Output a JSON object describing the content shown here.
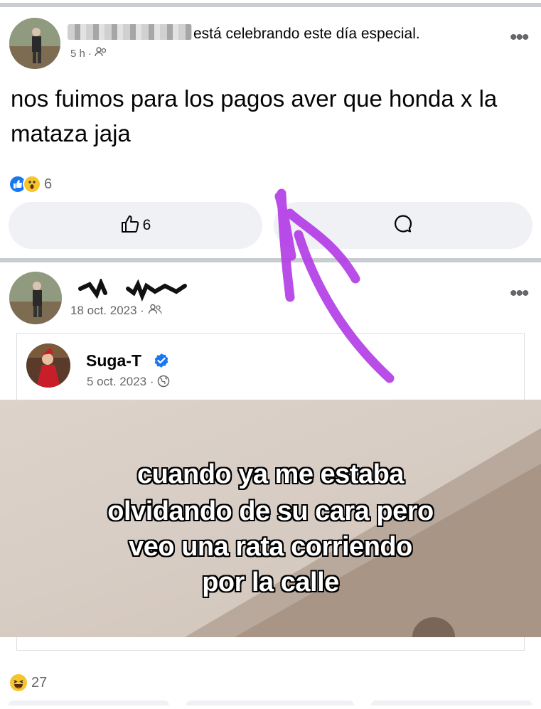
{
  "post1": {
    "author_suffix": "está celebrando este día especial.",
    "time": "5 h",
    "text": "nos fuimos para los pagos aver que honda x la mataza jaja",
    "reaction_count": "6",
    "like_count": "6",
    "icons": [
      "like-icon",
      "wow-icon",
      "thumb-outline-icon",
      "comment-icon",
      "friends-icon",
      "more-icon"
    ]
  },
  "post2": {
    "date": "18 oct. 2023",
    "shared": {
      "name": "Suga-T",
      "date": "5 oct. 2023",
      "caption_lines": [
        "cuando ya me estaba",
        "olvidando de su cara pero",
        "veo una rata corriendo",
        "por la calle"
      ]
    },
    "reaction_count": "27",
    "icons": [
      "haha-icon",
      "globe-icon",
      "verified-icon",
      "friends-icon",
      "more-icon"
    ]
  },
  "colors": {
    "facebook_blue": "#1877f2",
    "annotation_purple": "#b43ee6",
    "button_bg": "#eff1f5",
    "meta_gray": "#65676b"
  }
}
